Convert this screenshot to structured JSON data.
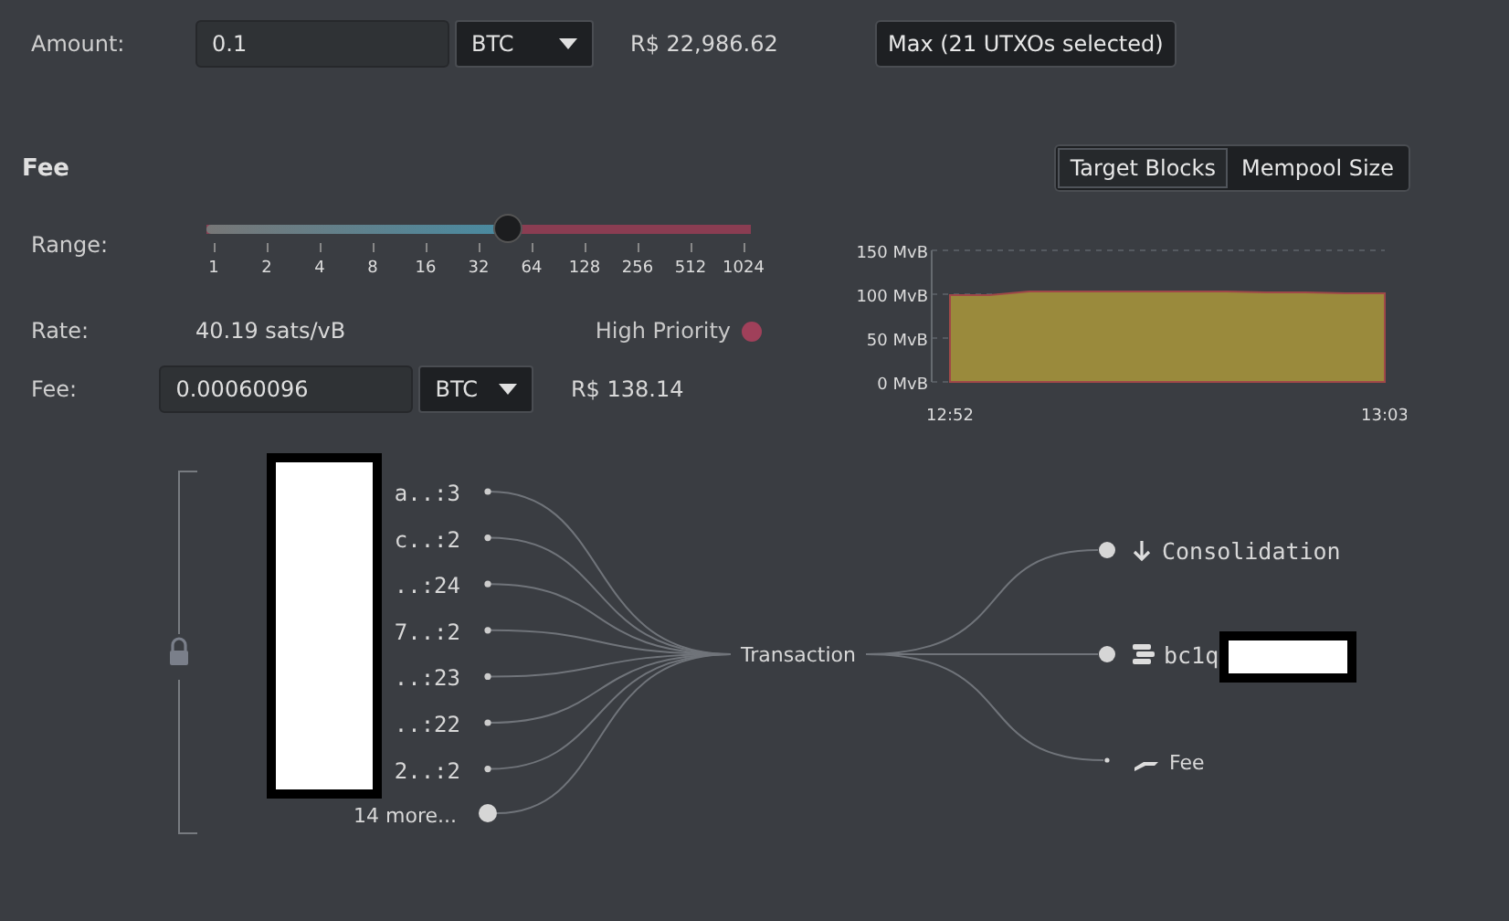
{
  "amount": {
    "label": "Amount:",
    "value": "0.1",
    "unit": "BTC",
    "fiat": "R$ 22,986.62",
    "max_button": "Max (21 UTXOs selected)"
  },
  "fee": {
    "title": "Fee",
    "tabs": [
      {
        "label": "Target Blocks",
        "selected": true
      },
      {
        "label": "Mempool Size",
        "selected": false
      }
    ],
    "range": {
      "label": "Range:",
      "level": 0.53,
      "ticks": [
        "1",
        "2",
        "4",
        "8",
        "16",
        "32",
        "64",
        "128",
        "256",
        "512",
        "1024"
      ]
    },
    "rate": {
      "label": "Rate:",
      "value": "40.19 sats/vB",
      "priority": "High Priority",
      "color": "#a0405a"
    },
    "fee_field": {
      "label": "Fee:",
      "value": "0.00060096",
      "unit": "BTC",
      "fiat": "R$ 138.14"
    },
    "chart_data": {
      "type": "area",
      "categories": [
        "12:52",
        null,
        null,
        null,
        null,
        null,
        null,
        null,
        null,
        null,
        null,
        "13:03"
      ],
      "series": [
        {
          "color": "#9a8a3c",
          "values": [
            99,
            99,
            103,
            103,
            103,
            103,
            103,
            103,
            102,
            102,
            101,
            101
          ]
        }
      ],
      "ylim": [
        0,
        150
      ],
      "yticks": [
        {
          "value": 0,
          "label": "0 MvB"
        },
        {
          "value": 50,
          "label": "50 MvB"
        },
        {
          "value": 100,
          "label": "100 MvB"
        },
        {
          "value": 150,
          "label": "150 MvB"
        }
      ]
    }
  },
  "diagram": {
    "inputs": [
      {
        "label": "a..:3"
      },
      {
        "label": "c..:2"
      },
      {
        "label": "..:24"
      },
      {
        "label": "7..:2"
      },
      {
        "label": "..:23"
      },
      {
        "label": "..:22"
      },
      {
        "label": "2..:2"
      }
    ],
    "more": "14 more...",
    "transaction": "Transaction",
    "outputs": [
      {
        "kind": "change",
        "label": "Consolidation"
      },
      {
        "kind": "address",
        "label": "bc1q"
      },
      {
        "kind": "fee",
        "label": "Fee"
      }
    ]
  }
}
